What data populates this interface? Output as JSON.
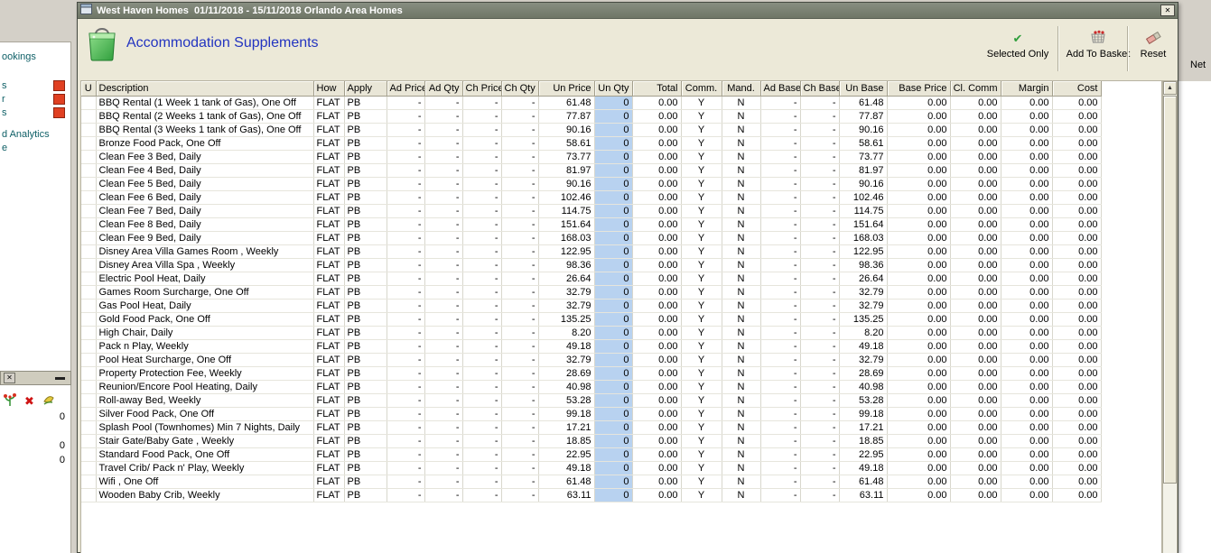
{
  "window": {
    "title": "West Haven Homes  01/11/2018 - 15/11/2018 Orlando Area Homes"
  },
  "header": {
    "title": "Accommodation Supplements"
  },
  "toolbar": {
    "selected_only": "Selected Only",
    "add_to_basket": "Add To Basket",
    "reset": "Reset"
  },
  "icons": {
    "check": "✔",
    "close_x": "✕",
    "delete_x": "✖",
    "scroll_up_arrow": "▲"
  },
  "colors": {
    "title_bar": "#7d8477",
    "heading_blue": "#2334c0",
    "qty_column_highlight": "#b8d2f0",
    "check_green": "#2f9e3c",
    "red_icon": "#e04022"
  },
  "table": {
    "columns": [
      "U",
      "Description",
      "How",
      "Apply",
      "Ad Price",
      "Ad Qty",
      "Ch Price",
      "Ch Qty",
      "Un Price",
      "Un Qty",
      "Total",
      "Comm.",
      "Mand.",
      "Ad Base",
      "Ch Base",
      "Un Base",
      "Base Price",
      "Cl. Comm",
      "Margin",
      "Cost"
    ],
    "row_template": {
      "u": "",
      "how": "FLAT",
      "apply": "PB",
      "ad_price": "-",
      "ad_qty": "-",
      "ch_price": "-",
      "ch_qty": "-",
      "un_qty": "0",
      "total": "0.00",
      "comm": "Y",
      "mand": "N",
      "ad_base": "-",
      "ch_base": "-",
      "base_price": "0.00",
      "cl_comm": "0.00",
      "margin": "0.00",
      "cost": "0.00"
    },
    "rows": [
      {
        "description": "BBQ Rental (1 Week 1 tank of Gas), One Off",
        "un_price": "61.48",
        "un_base": "61.48"
      },
      {
        "description": "BBQ Rental (2 Weeks 1 tank of Gas), One Off",
        "un_price": "77.87",
        "un_base": "77.87"
      },
      {
        "description": "BBQ Rental (3 Weeks 1 tank of Gas), One Off",
        "un_price": "90.16",
        "un_base": "90.16"
      },
      {
        "description": "Bronze Food Pack, One Off",
        "un_price": "58.61",
        "un_base": "58.61"
      },
      {
        "description": "Clean Fee 3 Bed, Daily",
        "un_price": "73.77",
        "un_base": "73.77"
      },
      {
        "description": "Clean Fee 4 Bed, Daily",
        "un_price": "81.97",
        "un_base": "81.97"
      },
      {
        "description": "Clean Fee 5 Bed, Daily",
        "un_price": "90.16",
        "un_base": "90.16"
      },
      {
        "description": "Clean Fee 6 Bed, Daily",
        "un_price": "102.46",
        "un_base": "102.46"
      },
      {
        "description": "Clean Fee 7 Bed, Daily",
        "un_price": "114.75",
        "un_base": "114.75"
      },
      {
        "description": "Clean Fee 8 Bed, Daily",
        "un_price": "151.64",
        "un_base": "151.64"
      },
      {
        "description": "Clean Fee 9 Bed, Daily",
        "un_price": "168.03",
        "un_base": "168.03"
      },
      {
        "description": "Disney Area Villa Games Room , Weekly",
        "un_price": "122.95",
        "un_base": "122.95"
      },
      {
        "description": "Disney Area Villa Spa , Weekly",
        "un_price": "98.36",
        "un_base": "98.36"
      },
      {
        "description": "Electric Pool Heat, Daily",
        "un_price": "26.64",
        "un_base": "26.64"
      },
      {
        "description": "Games Room Surcharge, One Off",
        "un_price": "32.79",
        "un_base": "32.79"
      },
      {
        "description": "Gas Pool Heat, Daily",
        "un_price": "32.79",
        "un_base": "32.79"
      },
      {
        "description": "Gold Food Pack, One Off",
        "un_price": "135.25",
        "un_base": "135.25"
      },
      {
        "description": "High Chair, Daily",
        "un_price": "8.20",
        "un_base": "8.20"
      },
      {
        "description": "Pack n Play, Weekly",
        "un_price": "49.18",
        "un_base": "49.18"
      },
      {
        "description": "Pool Heat Surcharge, One Off",
        "un_price": "32.79",
        "un_base": "32.79"
      },
      {
        "description": "Property Protection Fee, Weekly",
        "un_price": "28.69",
        "un_base": "28.69"
      },
      {
        "description": "Reunion/Encore Pool Heating, Daily",
        "un_price": "40.98",
        "un_base": "40.98"
      },
      {
        "description": "Roll-away Bed, Weekly",
        "un_price": "53.28",
        "un_base": "53.28"
      },
      {
        "description": "Silver Food Pack, One Off",
        "un_price": "99.18",
        "un_base": "99.18"
      },
      {
        "description": "Splash Pool (Townhomes) Min 7 Nights, Daily",
        "un_price": "17.21",
        "un_base": "17.21"
      },
      {
        "description": "Stair Gate/Baby Gate , Weekly",
        "un_price": "18.85",
        "un_base": "18.85"
      },
      {
        "description": "Standard Food Pack, One Off",
        "un_price": "22.95",
        "un_base": "22.95"
      },
      {
        "description": "Travel Crib/ Pack n' Play, Weekly",
        "un_price": "49.18",
        "un_base": "49.18"
      },
      {
        "description": "Wifi , One Off",
        "un_price": "61.48",
        "un_base": "61.48"
      },
      {
        "description": "Wooden Baby Crib, Weekly",
        "un_price": "63.11",
        "un_base": "63.11"
      }
    ]
  },
  "background": {
    "left_fragments": [
      "ookings",
      "s",
      "r",
      "s"
    ],
    "analytics_fragment": "d Analytics",
    "extra_fragment": "e",
    "right_fragment": "Net",
    "counters": [
      "0",
      "0",
      "0"
    ]
  }
}
